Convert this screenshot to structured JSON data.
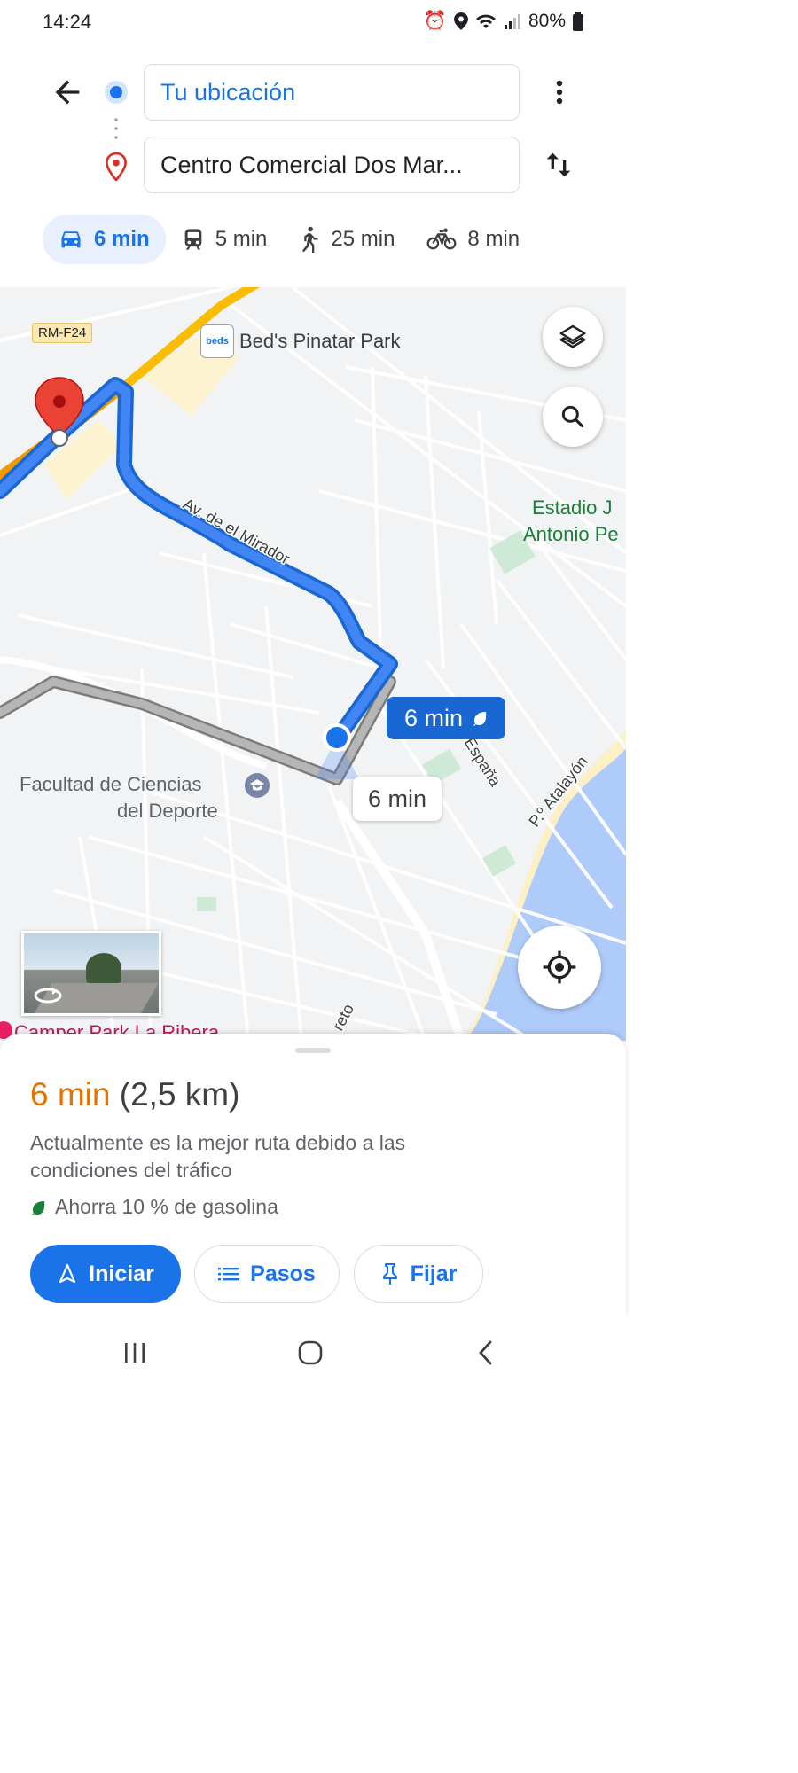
{
  "status_bar": {
    "time": "14:24",
    "battery": "80%"
  },
  "route_inputs": {
    "origin": "Tu ubicación",
    "destination": "Centro Comercial Dos Mar..."
  },
  "modes": [
    {
      "name": "car",
      "time": "6 min",
      "active": true
    },
    {
      "name": "transit",
      "time": "5 min"
    },
    {
      "name": "walk",
      "time": "25 min"
    },
    {
      "name": "bike",
      "time": "8 min"
    }
  ],
  "map": {
    "road_badge": "RM-F24",
    "place_hotel": "Bed's Pinatar Park",
    "hotel_logo": "beds",
    "place_stadium_line1": "Estadio J",
    "place_stadium_line2": "Antonio Pe",
    "place_faculty_line1": "Facultad de Ciencias",
    "place_faculty_line2": "del Deporte",
    "street_mirador": "Av. de el Mirador",
    "street_espana": "e España",
    "street_atalayon": "P.º Atalayón",
    "street_reto": "reto",
    "camper": "Camper Park La Ribera",
    "route_badge_primary": "6 min",
    "route_badge_alt": "6 min"
  },
  "summary": {
    "duration": "6 min",
    "distance": "(2,5 km)",
    "description": "Actualmente es la mejor ruta debido a las condiciones del tráfico",
    "savings": "Ahorra 10 % de gasolina"
  },
  "actions": {
    "start": "Iniciar",
    "steps": "Pasos",
    "pin": "Fijar"
  },
  "colors": {
    "accent": "#1a73e8",
    "duration": "#e37400",
    "eco": "#188038"
  }
}
